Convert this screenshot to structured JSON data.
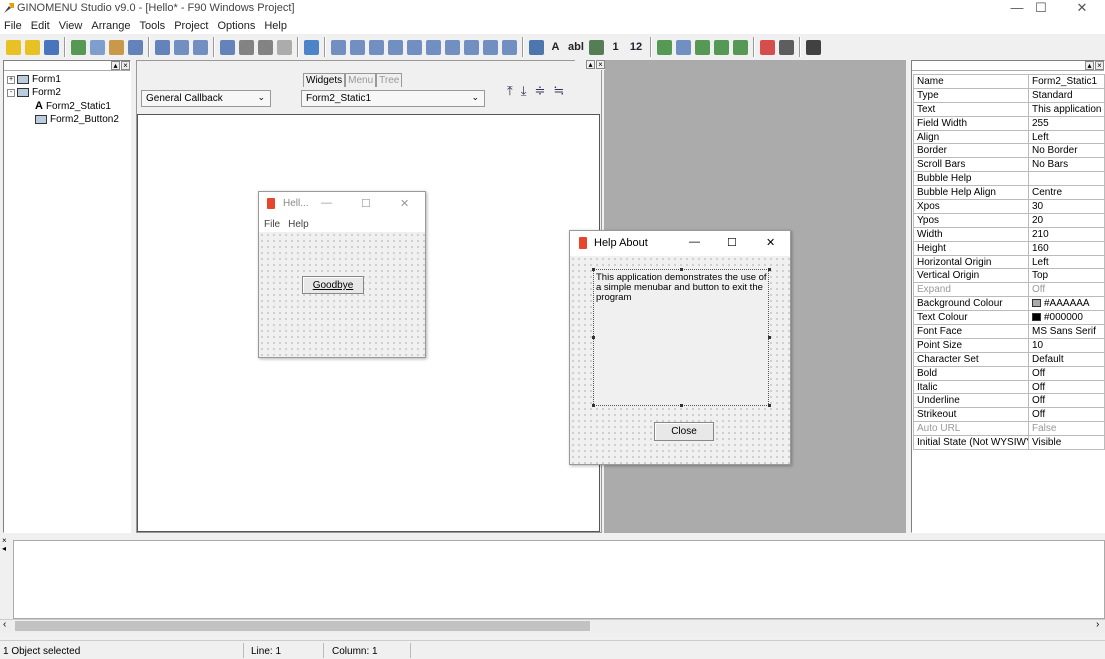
{
  "window": {
    "title": "GINOMENU Studio v9.0 - [Hello* - F90 Windows Project]"
  },
  "menu": [
    "File",
    "Edit",
    "View",
    "Arrange",
    "Tools",
    "Project",
    "Options",
    "Help"
  ],
  "toolbar": {
    "icons": [
      "new-icon",
      "open-icon",
      "save-icon",
      "check-icon",
      "copy-icon",
      "paste-icon",
      "select-all-icon",
      "align-icon",
      "stack-icon",
      "window-icon",
      "page-icon",
      "gear-icon",
      "run-icon",
      "stop-icon",
      "pointer-icon",
      "panel-icon",
      "tabs-icon",
      "frame-icon",
      "list-icon",
      "combo-icon",
      "slider-icon",
      "button-icon",
      "image-icon",
      "toggle-icon",
      "checkbox-icon",
      "radio-icon",
      "label-icon",
      "edit-icon",
      "memo-icon",
      "number-icon",
      "int-icon",
      "grid-icon",
      "table-icon",
      "progress-icon",
      "gauge-icon",
      "tree-icon",
      "chart-icon",
      "arrows-icon",
      "console-icon"
    ],
    "glyphs": {
      "label-icon": "A",
      "number-icon": "1",
      "edit-icon": "abl",
      "int-icon": "12"
    }
  },
  "tree": {
    "items": [
      {
        "label": "Form1",
        "toggle": "+"
      },
      {
        "label": "Form2",
        "toggle": "-"
      },
      {
        "label": "Form2_Static1",
        "glyph": "A"
      },
      {
        "label": "Form2_Button2"
      }
    ]
  },
  "editor": {
    "callback": "General Callback",
    "widget": "Form2_Static1",
    "tabs": [
      "Widgets",
      "Menu",
      "Tree"
    ]
  },
  "form1": {
    "title": "Hell...",
    "menu": [
      "File",
      "Help"
    ],
    "button": "Goodbye",
    "controls": [
      "—",
      "☐",
      "✕"
    ]
  },
  "form2": {
    "title": "Help About",
    "text": "This application demonstrates the use of a simple menubar and button to exit the program",
    "button": "Close",
    "controls": [
      "—",
      "☐",
      "✕"
    ]
  },
  "properties": [
    {
      "name": "Name",
      "value": "Form2_Static1"
    },
    {
      "name": "Type",
      "value": "Standard"
    },
    {
      "name": "Text",
      "value": "This application de"
    },
    {
      "name": "Field Width",
      "value": "255"
    },
    {
      "name": "Align",
      "value": "Left"
    },
    {
      "name": "Border",
      "value": "No Border"
    },
    {
      "name": "Scroll Bars",
      "value": "No Bars"
    },
    {
      "name": "Bubble Help",
      "value": ""
    },
    {
      "name": "Bubble Help Align",
      "value": "Centre"
    },
    {
      "name": "Xpos",
      "value": "30"
    },
    {
      "name": "Ypos",
      "value": "20"
    },
    {
      "name": "Width",
      "value": "210"
    },
    {
      "name": "Height",
      "value": "160"
    },
    {
      "name": "Horizontal Origin",
      "value": "Left"
    },
    {
      "name": "Vertical Origin",
      "value": "Top"
    },
    {
      "name": "Expand",
      "value": "Off",
      "disabled": true
    },
    {
      "name": "Background Colour",
      "value": "#AAAAAA",
      "swatch": "#aaaaaa"
    },
    {
      "name": "Text Colour",
      "value": "#000000",
      "swatch": "#000000"
    },
    {
      "name": "Font Face",
      "value": "MS Sans Serif"
    },
    {
      "name": "Point Size",
      "value": "10"
    },
    {
      "name": "Character Set",
      "value": "Default"
    },
    {
      "name": "Bold",
      "value": "Off"
    },
    {
      "name": "Italic",
      "value": "Off"
    },
    {
      "name": "Underline",
      "value": "Off"
    },
    {
      "name": "Strikeout",
      "value": "Off"
    },
    {
      "name": "Auto URL",
      "value": "False",
      "disabled": true
    },
    {
      "name": "Initial State (Not WYSIWYG)",
      "value": "Visible"
    }
  ],
  "status": {
    "selection": "1 Object selected",
    "line": "Line: 1",
    "column": "Column: 1"
  },
  "colors": {
    "canvas_gray": "#ababab",
    "tree_form_icon": "#bbccdd",
    "dialog_icon": "#e8452c"
  }
}
